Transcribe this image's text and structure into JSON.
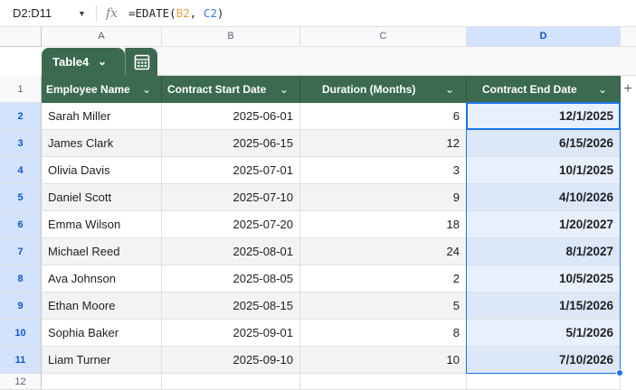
{
  "formula_bar": {
    "name_box": "D2:D11",
    "formula_prefix": "=EDATE(",
    "arg1": "B2",
    "separator": ", ",
    "arg2": "C2",
    "formula_suffix": ")"
  },
  "columns": [
    "A",
    "B",
    "C",
    "D"
  ],
  "selected_column": "D",
  "rows": [
    "1",
    "2",
    "3",
    "4",
    "5",
    "6",
    "7",
    "8",
    "9",
    "10",
    "11",
    "12"
  ],
  "table": {
    "name": "Table4",
    "headers": [
      "Employee Name",
      "Contract Start Date",
      "Duration (Months)",
      "Contract End Date"
    ],
    "data": [
      [
        "Sarah Miller",
        "2025-06-01",
        "6",
        "12/1/2025"
      ],
      [
        "James Clark",
        "2025-06-15",
        "12",
        "6/15/2026"
      ],
      [
        "Olivia Davis",
        "2025-07-01",
        "3",
        "10/1/2025"
      ],
      [
        "Daniel Scott",
        "2025-07-10",
        "9",
        "4/10/2026"
      ],
      [
        "Emma Wilson",
        "2025-07-20",
        "18",
        "1/20/2027"
      ],
      [
        "Michael Reed",
        "2025-08-01",
        "24",
        "8/1/2027"
      ],
      [
        "Ava Johnson",
        "2025-08-05",
        "2",
        "10/5/2025"
      ],
      [
        "Ethan Moore",
        "2025-08-15",
        "5",
        "1/15/2026"
      ],
      [
        "Sophia Baker",
        "2025-09-01",
        "8",
        "5/1/2026"
      ],
      [
        "Liam Turner",
        "2025-09-10",
        "10",
        "7/10/2026"
      ]
    ]
  },
  "icons": {
    "name_box_dropdown": "caret-down-icon",
    "formula": "fx-icon",
    "table_menu": "chevron-down-icon",
    "table_grid": "table-grid-icon",
    "add_column": "plus-icon"
  },
  "colors": {
    "table_header": "#3b6a50",
    "selection": "#1a73e8",
    "selected_header": "#d3e3fd"
  }
}
